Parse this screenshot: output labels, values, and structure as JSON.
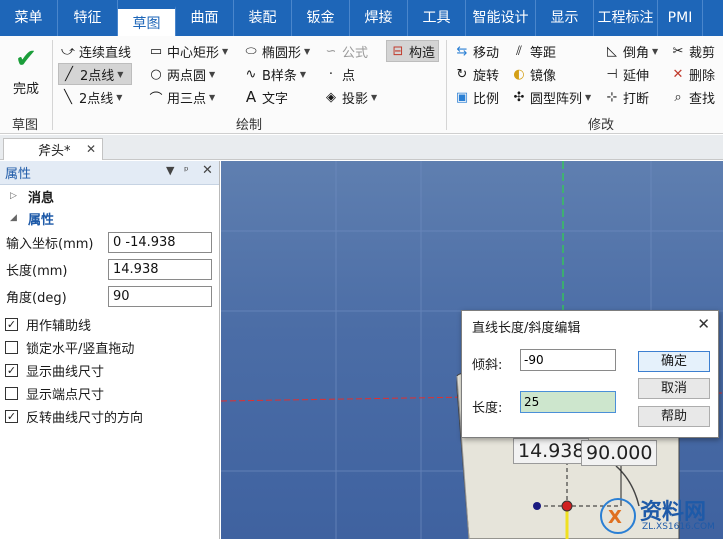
{
  "menu": {
    "items": [
      {
        "label": "菜单",
        "w": 58
      },
      {
        "label": "特征",
        "w": 60
      },
      {
        "label": "草图",
        "w": 58,
        "active": true
      },
      {
        "label": "曲面",
        "w": 58
      },
      {
        "label": "装配",
        "w": 58
      },
      {
        "label": "钣金",
        "w": 58
      },
      {
        "label": "焊接",
        "w": 58
      },
      {
        "label": "工具",
        "w": 58
      },
      {
        "label": "智能设计",
        "w": 70
      },
      {
        "label": "显示",
        "w": 58
      },
      {
        "label": "工程标注",
        "w": 64
      },
      {
        "label": "PMI",
        "w": 45
      }
    ]
  },
  "ribbon": {
    "done_label": "完成",
    "groups": {
      "sketch": "草图",
      "draw": "绘制",
      "modify": "修改"
    },
    "draw": {
      "polyline": "连续直线",
      "two_point_line": "2点线",
      "two_point_line2": "2点线",
      "center_rect": "中心矩形",
      "two_point_circle": "两点圆",
      "three_point_arc": "用三点",
      "ellipse": "椭圆形",
      "bspline": "B样条",
      "text": "文字",
      "formula": "公式",
      "point": "点",
      "project": "投影",
      "construct": "构造"
    },
    "modify": {
      "move": "移动",
      "offset": "等距",
      "rotate": "旋转",
      "mirror": "镜像",
      "scale": "比例",
      "circular_array": "圆型阵列",
      "chamfer": "倒角",
      "extend": "延伸",
      "break": "打断",
      "trim": "裁剪",
      "delete": "删除",
      "check": "查找"
    }
  },
  "doc_tab": {
    "label": "斧头*"
  },
  "properties": {
    "title": "属性",
    "sections": {
      "message": "消息",
      "props": "属性"
    },
    "fields": [
      {
        "label": "输入坐标(mm)",
        "value": "0 -14.938"
      },
      {
        "label": "长度(mm)",
        "value": "14.938"
      },
      {
        "label": "角度(deg)",
        "value": "90"
      }
    ],
    "checks": [
      {
        "label": "用作辅助线",
        "checked": true
      },
      {
        "label": "锁定水平/竖直拖动",
        "checked": false
      },
      {
        "label": "显示曲线尺寸",
        "checked": true
      },
      {
        "label": "显示端点尺寸",
        "checked": false
      },
      {
        "label": "反转曲线尺寸的方向",
        "checked": true
      }
    ]
  },
  "dialog": {
    "title": "直线长度/斜度编辑",
    "slope_label": "倾斜:",
    "slope_value": "-90",
    "length_label": "长度:",
    "length_value": "25",
    "ok": "确定",
    "cancel": "取消",
    "help": "帮助"
  },
  "dimensions": {
    "length": "14.938",
    "angle": "90.000"
  },
  "watermark": {
    "text": "资料网",
    "url": "ZL.XS1616.COM"
  },
  "colors": {
    "menu_bg": "#1e66b8",
    "viewport": "#4b6da6",
    "accent_green": "#1b9e3a"
  }
}
